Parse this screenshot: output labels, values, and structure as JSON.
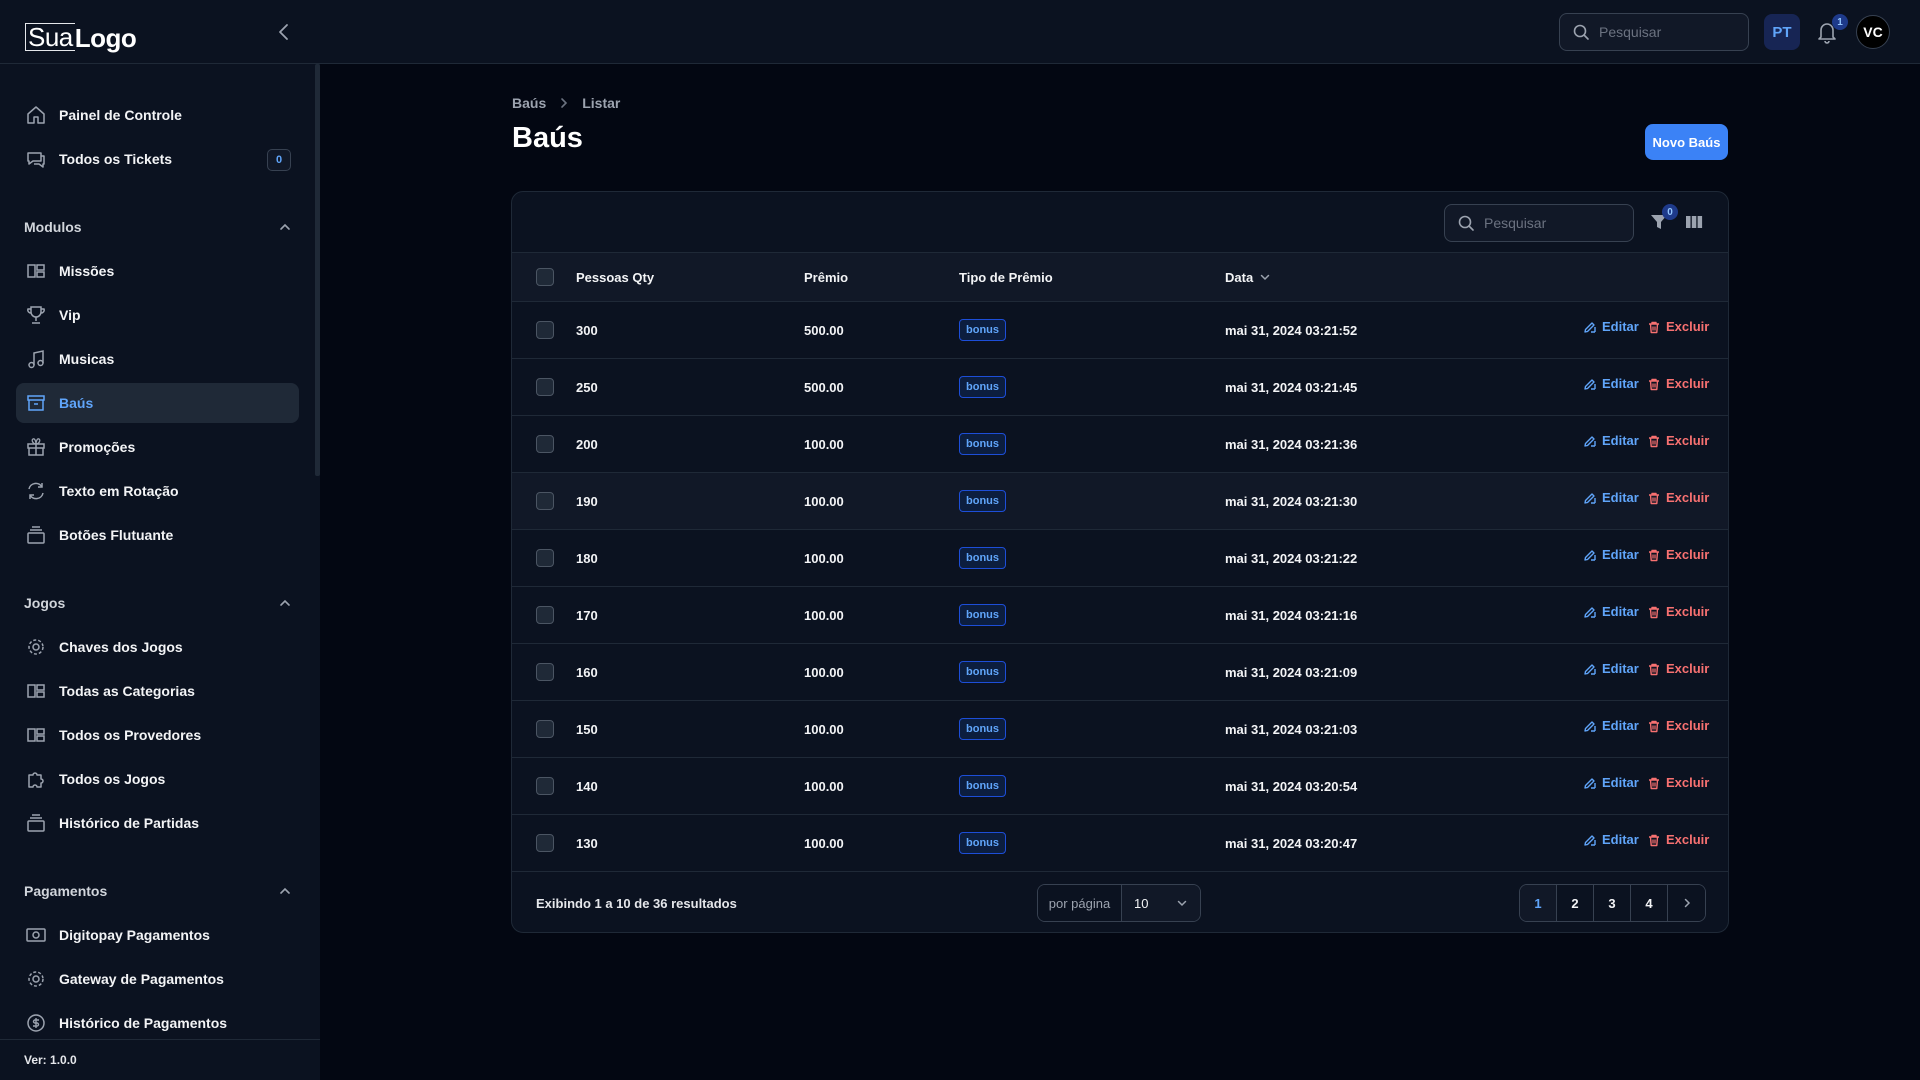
{
  "header": {
    "logo_part1": "Sua",
    "logo_part2": "Logo",
    "search_placeholder": "Pesquisar",
    "language": "PT",
    "notification_count": "1",
    "avatar_initials": "VC"
  },
  "sidebar": {
    "top_items": [
      {
        "label": "Painel de Controle",
        "icon": "home-icon"
      },
      {
        "label": "Todos os Tickets",
        "icon": "chat-icon",
        "count": "0"
      }
    ],
    "groups": [
      {
        "label": "Modulos",
        "items": [
          {
            "label": "Missões",
            "icon": "grid-icon"
          },
          {
            "label": "Vip",
            "icon": "trophy-icon"
          },
          {
            "label": "Musicas",
            "icon": "music-icon"
          },
          {
            "label": "Baús",
            "icon": "archive-icon",
            "active": true
          },
          {
            "label": "Promoções",
            "icon": "gift-icon"
          },
          {
            "label": "Texto em Rotação",
            "icon": "refresh-icon"
          },
          {
            "label": "Botões Flutuante",
            "icon": "stack-icon"
          }
        ]
      },
      {
        "label": "Jogos",
        "items": [
          {
            "label": "Chaves dos Jogos",
            "icon": "gear-icon"
          },
          {
            "label": "Todas as Categorias",
            "icon": "grid-icon"
          },
          {
            "label": "Todos os Provedores",
            "icon": "grid-icon"
          },
          {
            "label": "Todos os Jogos",
            "icon": "puzzle-icon"
          },
          {
            "label": "Histórico de Partidas",
            "icon": "stack-icon"
          }
        ]
      },
      {
        "label": "Pagamentos",
        "items": [
          {
            "label": "Digitopay Pagamentos",
            "icon": "banknote-icon"
          },
          {
            "label": "Gateway de Pagamentos",
            "icon": "gear-icon"
          },
          {
            "label": "Histórico de Pagamentos",
            "icon": "dollar-icon"
          }
        ]
      }
    ],
    "version": "Ver: 1.0.0"
  },
  "breadcrumb": {
    "root": "Baús",
    "current": "Listar"
  },
  "page": {
    "title": "Baús",
    "new_button": "Novo Baús"
  },
  "table": {
    "search_placeholder": "Pesquisar",
    "filter_count": "0",
    "columns": {
      "people": "Pessoas Qty",
      "prize": "Prêmio",
      "prize_type": "Tipo de Prêmio",
      "date": "Data"
    },
    "edit_label": "Editar",
    "delete_label": "Excluir",
    "rows": [
      {
        "people": "300",
        "prize": "500.00",
        "type": "bonus",
        "date": "mai 31, 2024 03:21:52"
      },
      {
        "people": "250",
        "prize": "500.00",
        "type": "bonus",
        "date": "mai 31, 2024 03:21:45"
      },
      {
        "people": "200",
        "prize": "100.00",
        "type": "bonus",
        "date": "mai 31, 2024 03:21:36"
      },
      {
        "people": "190",
        "prize": "100.00",
        "type": "bonus",
        "date": "mai 31, 2024 03:21:30"
      },
      {
        "people": "180",
        "prize": "100.00",
        "type": "bonus",
        "date": "mai 31, 2024 03:21:22"
      },
      {
        "people": "170",
        "prize": "100.00",
        "type": "bonus",
        "date": "mai 31, 2024 03:21:16"
      },
      {
        "people": "160",
        "prize": "100.00",
        "type": "bonus",
        "date": "mai 31, 2024 03:21:09"
      },
      {
        "people": "150",
        "prize": "100.00",
        "type": "bonus",
        "date": "mai 31, 2024 03:21:03"
      },
      {
        "people": "140",
        "prize": "100.00",
        "type": "bonus",
        "date": "mai 31, 2024 03:20:54"
      },
      {
        "people": "130",
        "prize": "100.00",
        "type": "bonus",
        "date": "mai 31, 2024 03:20:47"
      }
    ],
    "summary": "Exibindo 1 a 10 de 36 resultados",
    "per_page_label": "por página",
    "per_page_value": "10",
    "pages": [
      "1",
      "2",
      "3",
      "4"
    ],
    "current_page": "1"
  },
  "colors": {
    "accent": "#3b82f6",
    "danger": "#f87171",
    "background": "#030712",
    "surface": "#0b1220"
  }
}
